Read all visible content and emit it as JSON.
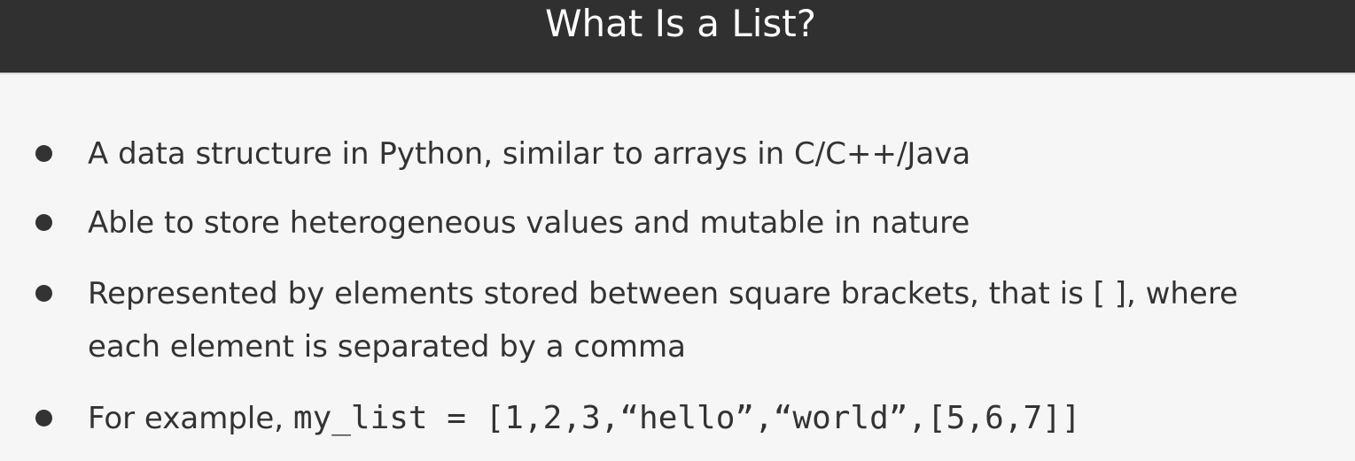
{
  "slide": {
    "title": "What Is a List?",
    "bullets": [
      {
        "text": "A data structure in Python, similar to arrays in C/C++/Java"
      },
      {
        "text": "Able to store heterogeneous values and mutable in nature"
      },
      {
        "line1": "Represented by elements stored between square brackets, that is [ ], where",
        "line2": "each element is separated by a comma"
      },
      {
        "prefix": "For example, ",
        "code": "my_list = [1,2,3,“hello”,“world”,[5,6,7]]"
      }
    ]
  },
  "colors": {
    "title_bar": "#303030",
    "title_text": "#ffffff",
    "background": "#f6f6f6",
    "body_text": "#333333"
  },
  "icons": {
    "bullet": "bullet-dot-icon"
  }
}
